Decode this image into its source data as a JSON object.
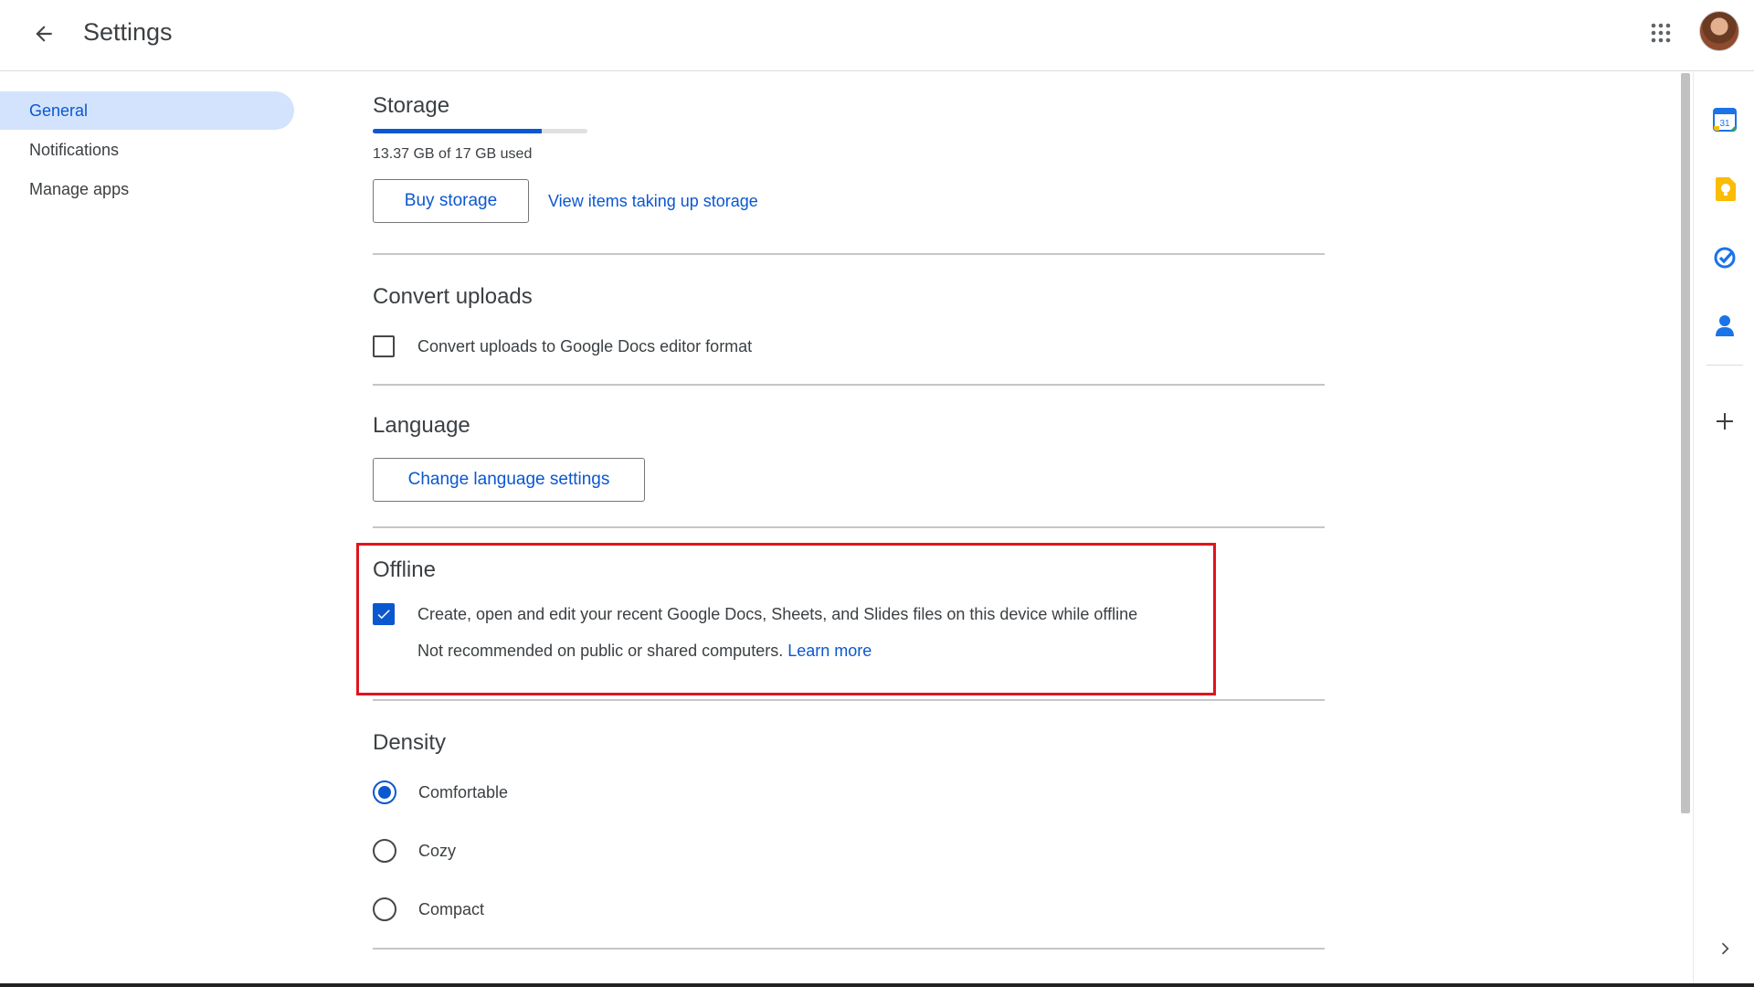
{
  "header": {
    "title": "Settings"
  },
  "sidebar": {
    "items": [
      {
        "label": "General"
      },
      {
        "label": "Notifications"
      },
      {
        "label": "Manage apps"
      }
    ]
  },
  "storage": {
    "title": "Storage",
    "used_fraction": 0.786,
    "usage_text": "13.37 GB of 17 GB used",
    "buy_label": "Buy storage",
    "view_items_label": "View items taking up storage"
  },
  "convert": {
    "title": "Convert uploads",
    "option_label": "Convert uploads to Google Docs editor format",
    "checked": false
  },
  "language": {
    "title": "Language",
    "button_label": "Change language settings"
  },
  "offline": {
    "title": "Offline",
    "option_label": "Create, open and edit your recent Google Docs, Sheets, and Slides files on this device while offline",
    "checked": true,
    "note": "Not recommended on public or shared computers.",
    "learn_more": "Learn more"
  },
  "density": {
    "title": "Density",
    "options": [
      {
        "label": "Comfortable",
        "selected": true
      },
      {
        "label": "Cozy",
        "selected": false
      },
      {
        "label": "Compact",
        "selected": false
      }
    ]
  },
  "side_panel": {
    "icons": [
      "calendar-icon",
      "keep-icon",
      "tasks-icon",
      "contacts-icon",
      "add-icon",
      "chevron-right-icon"
    ],
    "calendar_day": "31"
  },
  "colors": {
    "accent": "#0b57d0",
    "highlight": "#e0141e",
    "nav_active_bg": "#d3e3fd",
    "keep_yellow": "#fbbc04"
  }
}
